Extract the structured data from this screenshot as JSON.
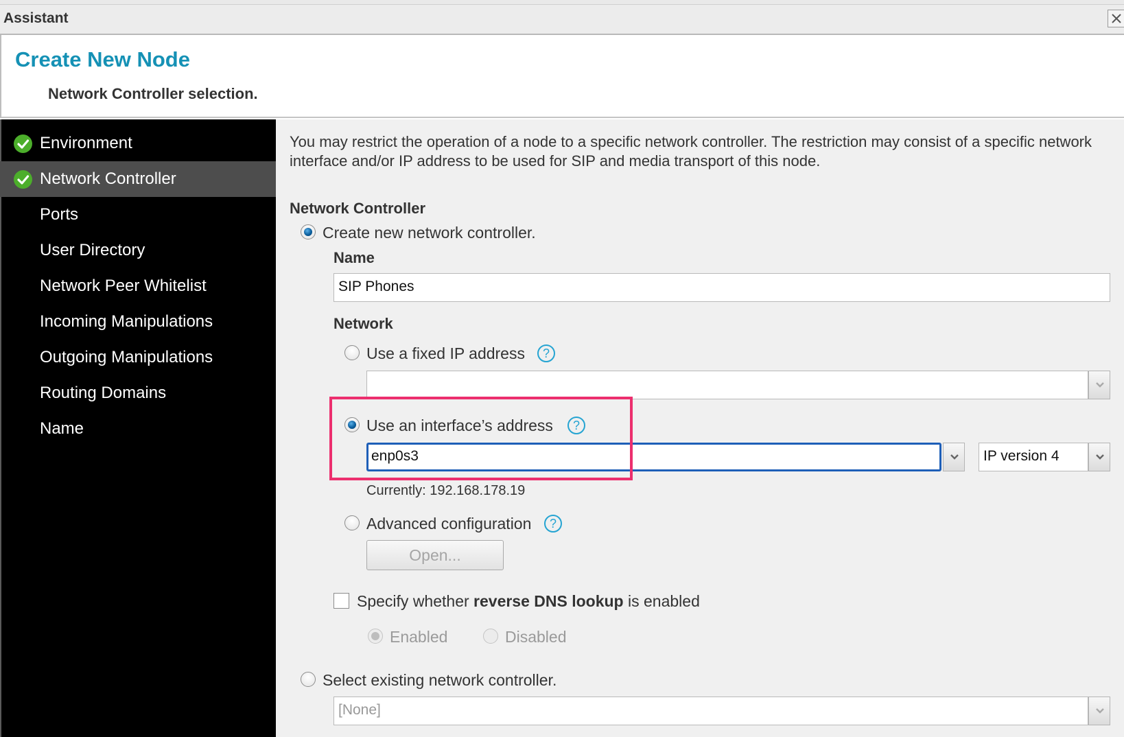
{
  "window": {
    "title": "Assistant"
  },
  "header": {
    "title": "Create New Node",
    "subtitle": "Network Controller selection."
  },
  "sidebar": {
    "items": [
      {
        "label": "Environment",
        "completed": true,
        "active": false
      },
      {
        "label": "Network Controller",
        "completed": true,
        "active": true
      },
      {
        "label": "Ports",
        "completed": false,
        "active": false
      },
      {
        "label": "User Directory",
        "completed": false,
        "active": false
      },
      {
        "label": "Network Peer Whitelist",
        "completed": false,
        "active": false
      },
      {
        "label": "Incoming Manipulations",
        "completed": false,
        "active": false
      },
      {
        "label": "Outgoing Manipulations",
        "completed": false,
        "active": false
      },
      {
        "label": "Routing Domains",
        "completed": false,
        "active": false
      },
      {
        "label": "Name",
        "completed": false,
        "active": false
      }
    ]
  },
  "main": {
    "intro": "You may restrict the operation of a node to a specific network controller. The restriction may consist of a specific network interface and/or IP address to be used for SIP and media transport of this node.",
    "section_title": "Network Controller",
    "create_new": {
      "label": "Create new network controller.",
      "selected": true,
      "name_label": "Name",
      "name_value": "SIP Phones",
      "network_label": "Network",
      "fixed_ip": {
        "label": "Use a fixed IP address",
        "selected": false,
        "value": "",
        "help": "?"
      },
      "interface": {
        "label": "Use an interface’s address",
        "selected": true,
        "value": "enp0s3",
        "help": "?",
        "ip_version": "IP version 4",
        "currently": "Currently: 192.168.178.19"
      },
      "advanced": {
        "label": "Advanced configuration",
        "selected": false,
        "help": "?",
        "open_button": "Open..."
      },
      "reverse_dns": {
        "label_prefix": "Specify whether ",
        "label_bold": "reverse DNS lookup",
        "label_suffix": " is enabled",
        "checked": false,
        "enabled_label": "Enabled",
        "disabled_label": "Disabled",
        "enabled_selected": true
      }
    },
    "select_existing": {
      "label": "Select existing network controller.",
      "selected": false,
      "value": "[None]"
    }
  },
  "colors": {
    "title_accent": "#1591b5",
    "sidebar_bg": "#000000",
    "sidebar_active": "#4d4d4d",
    "check_green": "#4cae2b",
    "highlight_box": "#ec2f6e",
    "focus_border": "#1e5fb8"
  }
}
